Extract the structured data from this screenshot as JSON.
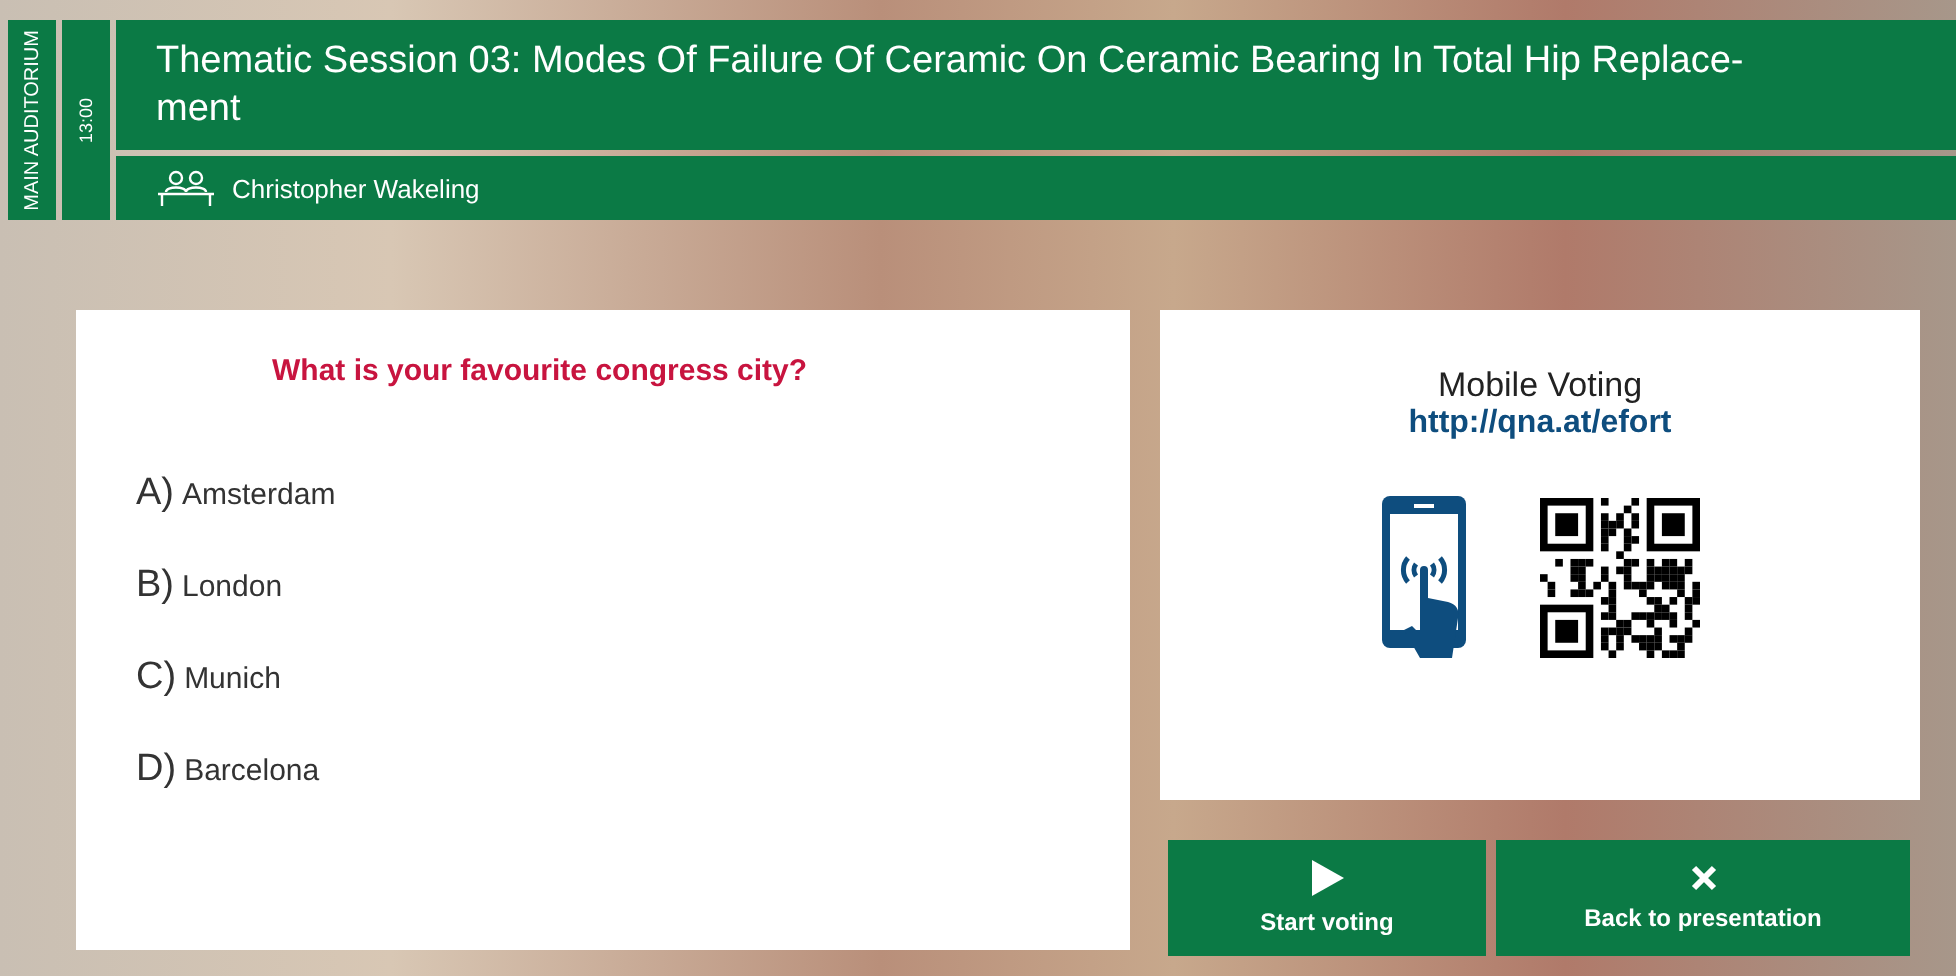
{
  "room": "MAIN AUDITORIUM",
  "time": "13:00",
  "session": {
    "title": "Thematic Session 03: Modes Of Failure Of Ceramic On Ceramic Bearing In Total Hip Replace-ment",
    "speaker": "Christopher Wakeling"
  },
  "question": {
    "text": "What is your favourite congress city?",
    "answers": [
      {
        "letter": "A)",
        "text": "Amsterdam"
      },
      {
        "letter": "B)",
        "text": "London"
      },
      {
        "letter": "C)",
        "text": "Munich"
      },
      {
        "letter": "D)",
        "text": "Barcelona"
      }
    ]
  },
  "voting": {
    "title": "Mobile Voting",
    "url": "http://qna.at/efort"
  },
  "buttons": [
    {
      "kind": "play",
      "label": "Start voting"
    },
    {
      "kind": "close",
      "label": "Back to presentation"
    }
  ]
}
